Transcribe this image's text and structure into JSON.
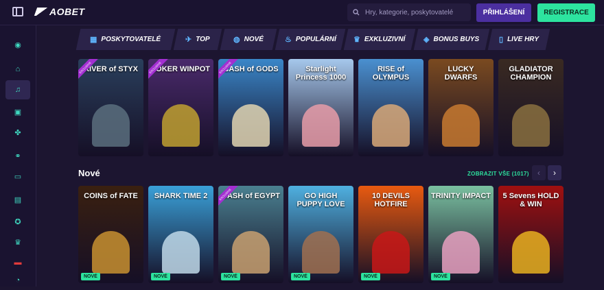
{
  "header": {
    "logo_text": "AOBET",
    "search_placeholder": "Hry, kategorie, poskytovatelé",
    "login_label": "PŘIHLÁŠENÍ",
    "register_label": "REGISTRACE"
  },
  "nav": {
    "categories": [
      {
        "label": "POSKYTOVATELÉ",
        "icon": "grid-icon"
      },
      {
        "label": "TOP",
        "icon": "rocket-icon"
      },
      {
        "label": "NOVÉ",
        "icon": "new-badge-icon"
      },
      {
        "label": "POPULÁRNÍ",
        "icon": "fire-icon"
      },
      {
        "label": "EXKLUZIVNÍ",
        "icon": "crown-icon"
      },
      {
        "label": "BONUS BUYS",
        "icon": "gift-icon"
      },
      {
        "label": "LIVE HRY",
        "icon": "card-icon"
      }
    ]
  },
  "sidebar": {
    "items": [
      {
        "icon": "casino-chip-icon"
      },
      {
        "icon": "home-icon"
      },
      {
        "icon": "music-icon"
      },
      {
        "icon": "sports-icon"
      },
      {
        "icon": "clover-icon"
      },
      {
        "icon": "live-icon"
      },
      {
        "icon": "virtual-icon"
      },
      {
        "icon": "tv-icon"
      },
      {
        "icon": "medal-icon"
      },
      {
        "icon": "trophy-icon"
      },
      {
        "icon": "czech-flag-icon"
      },
      {
        "icon": "support-icon"
      }
    ]
  },
  "top_games": [
    {
      "title": "RIVER of STYX",
      "ribbon": "EXCLUSIVE",
      "bg": "#2a3f5c",
      "art": "#5a6f7e"
    },
    {
      "title": "JOKER WINPOT",
      "ribbon": "EXCLUSIVE",
      "bg": "#4a2a6b",
      "art": "#c0a030"
    },
    {
      "title": "CASH of GODS",
      "ribbon": "EXCLUSIVE",
      "bg": "#3a86c8",
      "art": "#e0d4b0"
    },
    {
      "title": "Starlight Princess 1000",
      "ribbon": "",
      "bg": "#a6c8ec",
      "art": "#e89ca8"
    },
    {
      "title": "RISE of OLYMPUS",
      "ribbon": "",
      "bg": "#4a90d0",
      "art": "#d8a878"
    },
    {
      "title": "LUCKY DWARFS",
      "ribbon": "",
      "bg": "#7a4a20",
      "art": "#c87a30"
    },
    {
      "title": "GLADIATOR CHAMPION",
      "ribbon": "",
      "bg": "#3a2a22",
      "art": "#8a7040"
    }
  ],
  "section_new": {
    "title": "Nové",
    "view_all": "ZOBRAZIT VŠE (1017)"
  },
  "new_games": [
    {
      "title": "COINS of FATE",
      "ribbon": "",
      "bg": "#3a2010",
      "art": "#c89030",
      "badge": "NOVÉ"
    },
    {
      "title": "SHARK TIME 2",
      "ribbon": "",
      "bg": "#3aa0d8",
      "art": "#c0d8e8",
      "badge": "NOVÉ"
    },
    {
      "title": "CASH of EGYPT",
      "ribbon": "EXCLUSIVE",
      "bg": "#4a8090",
      "art": "#c8a070",
      "badge": "NOVÉ"
    },
    {
      "title": "GO HIGH PUPPY LOVE",
      "ribbon": "",
      "bg": "#4fb0e0",
      "art": "#a07050",
      "badge": "NOVÉ"
    },
    {
      "title": "10 DEVILS HOTFIRE",
      "ribbon": "",
      "bg": "#e85a10",
      "art": "#c81818",
      "badge": "NOVÉ"
    },
    {
      "title": "TRINITY IMPACT",
      "ribbon": "",
      "bg": "#7ac0a0",
      "art": "#e8a0c0",
      "badge": "NOVÉ"
    },
    {
      "title": "5 Sevens HOLD & WIN",
      "ribbon": "",
      "bg": "#a01010",
      "art": "#e8b020",
      "badge": ""
    }
  ]
}
